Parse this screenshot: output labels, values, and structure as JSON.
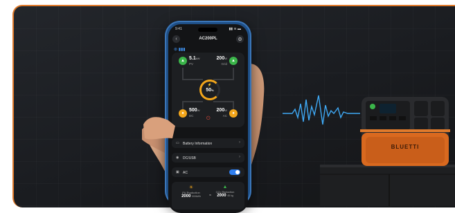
{
  "colors": {
    "accent": "#e07a2b",
    "green": "#3bb54a",
    "yellow": "#f3a61b",
    "blue": "#2f7ff0",
    "pulse": "#3fa9f5"
  },
  "phone": {
    "status_time": "9:41",
    "status_signal": "▮▮ ≋ ▬",
    "title": "AC200PL",
    "back_icon": "chevron-left-icon",
    "settings_icon": "gear-icon",
    "conn_icons": "⊛ ▮▮▮",
    "flow": {
      "pv": {
        "value": "5.1",
        "unit": "kW",
        "label": "PV"
      },
      "grid": {
        "value": "200",
        "unit": "W",
        "label": "Grid"
      },
      "battery": {
        "value": "50",
        "unit": "%"
      },
      "dc": {
        "value": "500",
        "unit": "W",
        "label": "DC"
      },
      "ac": {
        "value": "200",
        "unit": "W",
        "label": "AC"
      }
    },
    "rows": {
      "battery_info": "Battery Information",
      "dcusb": "DC/USB",
      "ac": "AC",
      "ac_toggle_on": true
    },
    "stats": {
      "pv_production_label": "PV Production",
      "pv_production_value": "2000",
      "pv_production_unit": "000kWh",
      "approx": "≈",
      "co2_label": "CO₂ Reduction",
      "co2_value": "2000",
      "co2_unit": "45 kg"
    }
  },
  "station": {
    "brand": "BLUETTI"
  }
}
